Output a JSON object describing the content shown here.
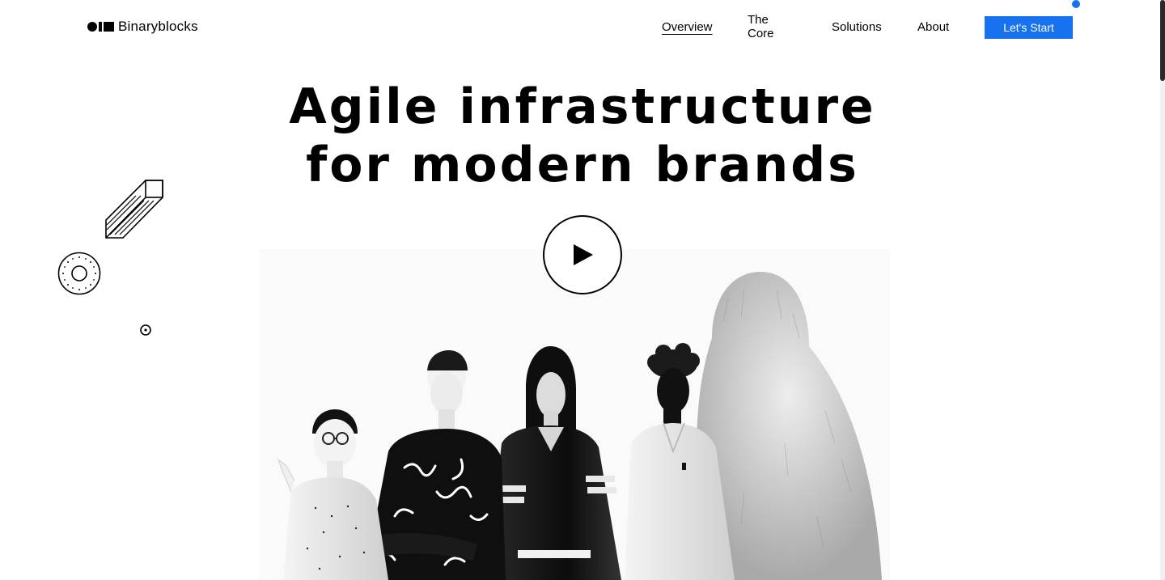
{
  "brand": {
    "name": "Binaryblocks",
    "logo_icon": "binary-blocks-logo-icon"
  },
  "nav": {
    "items": [
      {
        "label": "Overview",
        "active": true
      },
      {
        "label": "The Core",
        "active": false
      },
      {
        "label": "Solutions",
        "active": false
      },
      {
        "label": "About",
        "active": false
      }
    ],
    "cta_label": "Let's Start"
  },
  "hero": {
    "title_line1": "Agile infrastructure",
    "title_line2": "for modern brands",
    "play_icon": "play-icon"
  },
  "colors": {
    "accent": "#1672ee",
    "text": "#000000",
    "background": "#ffffff"
  },
  "decorations": [
    "pencil-outline-icon",
    "dotted-ring-icon",
    "small-circle-icon"
  ],
  "illustration": {
    "icon": "group-of-3d-figures-illustration"
  }
}
